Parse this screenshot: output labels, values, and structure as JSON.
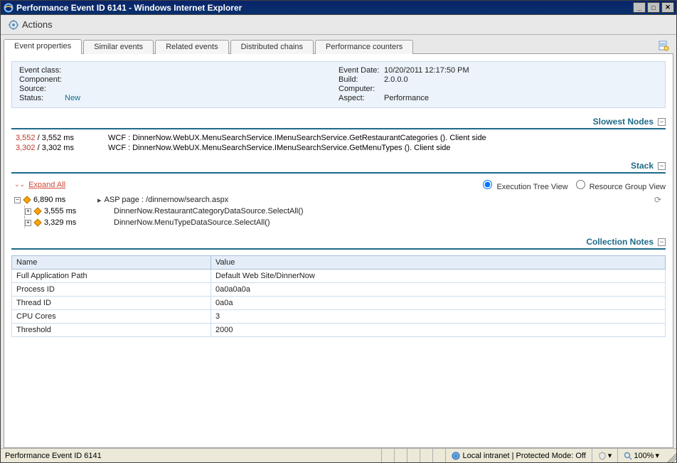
{
  "window": {
    "title": "Performance Event ID 6141 - Windows Internet Explorer",
    "min_tooltip": "_",
    "max_tooltip": "□",
    "close_tooltip": "✕"
  },
  "toolbar": {
    "actions_label": "Actions"
  },
  "tabs": [
    {
      "label": "Event properties",
      "active": true
    },
    {
      "label": "Similar events"
    },
    {
      "label": "Related events"
    },
    {
      "label": "Distributed chains"
    },
    {
      "label": "Performance counters"
    }
  ],
  "event": {
    "left": {
      "class_label": "Event class:",
      "class_value": "",
      "component_label": "Component:",
      "component_value": "",
      "source_label": "Source:",
      "source_value": "",
      "status_label": "Status:",
      "status_value": "New"
    },
    "right": {
      "date_label": "Event Date:",
      "date_value": "10/20/2011 12:17:50 PM",
      "build_label": "Build:",
      "build_value": "2.0.0.0",
      "computer_label": "Computer:",
      "computer_value": "",
      "aspect_label": "Aspect:",
      "aspect_value": "Performance"
    }
  },
  "slowest": {
    "title": "Slowest Nodes",
    "rows": [
      {
        "hot": "3,552",
        "total": "3,552 ms",
        "desc": "WCF : DinnerNow.WebUX.MenuSearchService.IMenuSearchService.GetRestaurantCategories (). Client side"
      },
      {
        "hot": "3,302",
        "total": "3,302 ms",
        "desc": "WCF : DinnerNow.WebUX.MenuSearchService.IMenuSearchService.GetMenuTypes (). Client side"
      }
    ]
  },
  "stack": {
    "title": "Stack",
    "expand_all": "Expand All",
    "view_exec": "Execution Tree View",
    "view_group": "Resource Group View",
    "tree": [
      {
        "level": 0,
        "toggle": "−",
        "time": "6,890 ms",
        "play": true,
        "desc": "ASP page : /dinnernow/search.aspx",
        "refresh": true
      },
      {
        "level": 1,
        "toggle": "+",
        "time": "3,555 ms",
        "desc": "DinnerNow.RestaurantCategoryDataSource.SelectAll()"
      },
      {
        "level": 1,
        "toggle": "+",
        "time": "3,329 ms",
        "desc": "DinnerNow.MenuTypeDataSource.SelectAll()"
      }
    ]
  },
  "notes": {
    "title": "Collection Notes",
    "header_name": "Name",
    "header_value": "Value",
    "rows": [
      {
        "name": "Full Application Path",
        "value": "Default Web Site/DinnerNow"
      },
      {
        "name": "Process ID",
        "value": "0a0a0a0a"
      },
      {
        "name": "Thread ID",
        "value": "0a0a"
      },
      {
        "name": "CPU Cores",
        "value": "3"
      },
      {
        "name": "Threshold",
        "value": "2000"
      }
    ]
  },
  "statusbar": {
    "page_title": "Performance Event ID 6141",
    "zone": "Local intranet | Protected Mode: Off",
    "zoom": "100%"
  }
}
